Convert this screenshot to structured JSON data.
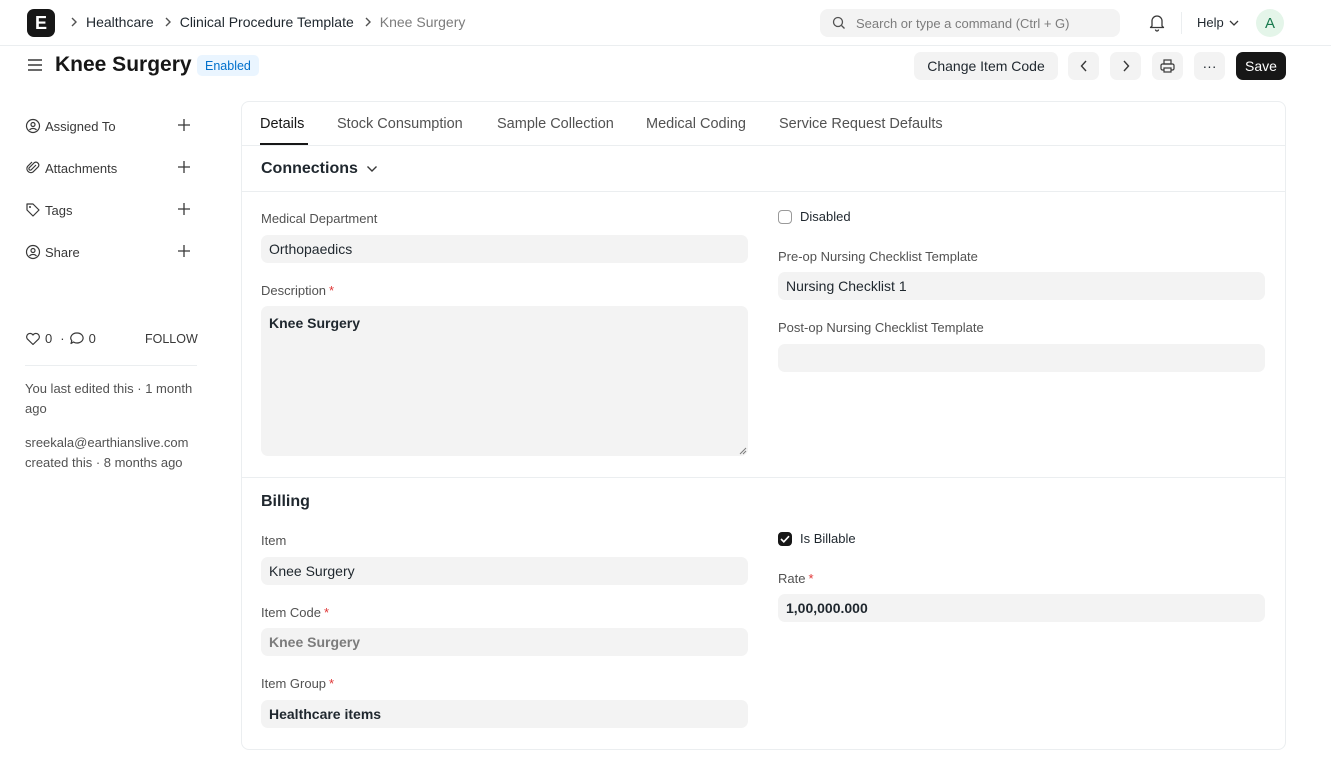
{
  "navbar": {
    "logo_letter": "E",
    "breadcrumbs": [
      "Healthcare",
      "Clinical Procedure Template",
      "Knee Surgery"
    ],
    "search_placeholder": "Search or type a command (Ctrl + G)",
    "help_label": "Help",
    "avatar_initial": "A"
  },
  "page": {
    "title": "Knee Surgery",
    "status_badge": "Enabled",
    "change_item_code_label": "Change Item Code",
    "more_label": "···",
    "save_label": "Save"
  },
  "sidebar": {
    "items": [
      {
        "label": "Assigned To"
      },
      {
        "label": "Attachments"
      },
      {
        "label": "Tags"
      },
      {
        "label": "Share"
      }
    ],
    "like_count": "0",
    "comment_count": "0",
    "follow_label": "FOLLOW",
    "last_edited": "You last edited this · 1 month ago",
    "creator": "sreekala@earthianslive.com",
    "created": "created this · 8 months ago"
  },
  "tabs": [
    "Details",
    "Stock Consumption",
    "Sample Collection",
    "Medical Coding",
    "Service Request Defaults"
  ],
  "connections": {
    "heading": "Connections"
  },
  "details": {
    "medical_department_label": "Medical Department",
    "medical_department_value": "Orthopaedics",
    "description_label": "Description",
    "description_value": "Knee Surgery",
    "disabled_label": "Disabled",
    "preop_label": "Pre-op Nursing Checklist Template",
    "preop_value": "Nursing Checklist 1",
    "postop_label": "Post-op Nursing Checklist Template",
    "postop_value": ""
  },
  "billing": {
    "heading": "Billing",
    "item_label": "Item",
    "item_value": "Knee Surgery",
    "item_code_label": "Item Code",
    "item_code_value": "Knee Surgery",
    "item_group_label": "Item Group",
    "item_group_value": "Healthcare items",
    "is_billable_label": "Is Billable",
    "is_billable_checked": true,
    "rate_label": "Rate",
    "rate_value": "1,00,000.000"
  },
  "colors": {
    "primary_button": "#171717",
    "badge_bg": "#eaf5ff",
    "badge_text": "#0070cc",
    "required_mark": "#e03636"
  }
}
